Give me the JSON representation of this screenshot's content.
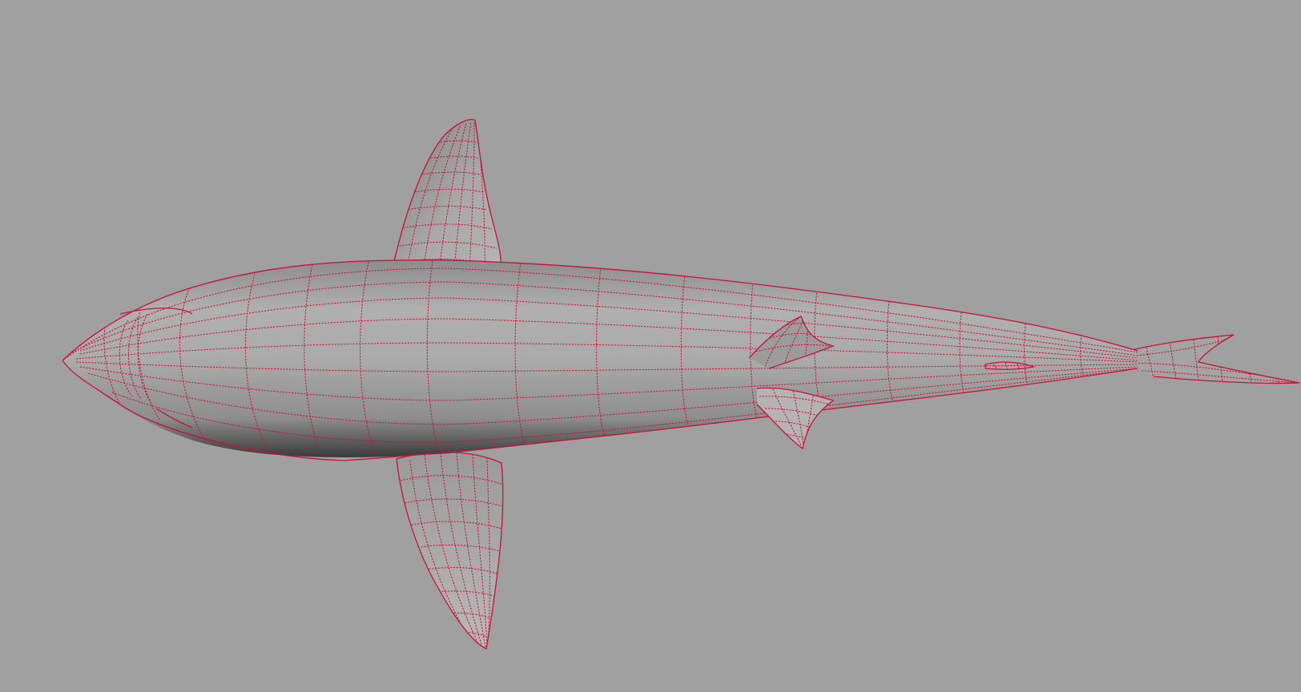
{
  "viewport": {
    "background_color": "#a0a0a0",
    "view": "3d-perspective",
    "display_mode": "smooth-shaded-with-wireframe-on-shaded"
  },
  "model": {
    "subject": "shark",
    "selected": true,
    "wireframe_color": "#c8103a",
    "surface_color": "#a8a8a8"
  }
}
